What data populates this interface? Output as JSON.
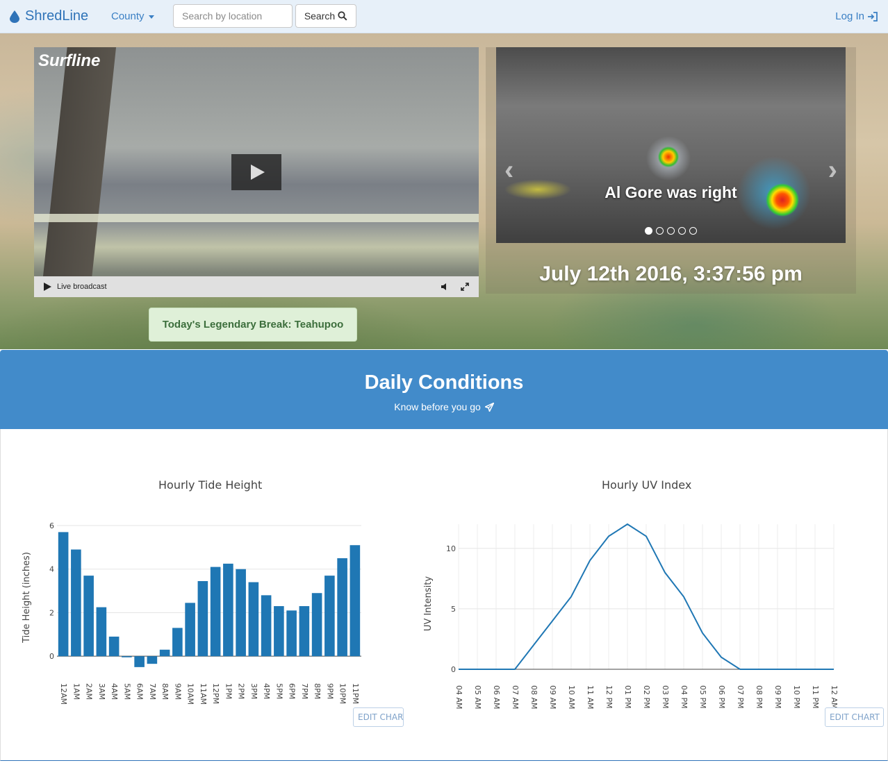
{
  "nav": {
    "brand": "ShredLine",
    "county_label": "County",
    "search_placeholder": "Search by location",
    "search_label": "Search",
    "login_label": "Log In"
  },
  "hero": {
    "video_logo": "Surfline",
    "video_status": "Live broadcast",
    "carousel_caption": "Al Gore was right",
    "carousel_slide_count": 5,
    "carousel_active_index": 0,
    "datetime": "July 12th 2016, 3:37:56 pm",
    "legendary_break": "Today's Legendary Break: Teahupoo"
  },
  "conditions": {
    "title": "Daily Conditions",
    "subtitle": "Know before you go"
  },
  "edit_chart_label": "EDIT CHART",
  "chart_data": [
    {
      "type": "bar",
      "title": "Hourly Tide Height",
      "xlabel": "",
      "ylabel": "Tide Height (inches)",
      "ylim": [
        -0.6,
        6
      ],
      "yticks": [
        0,
        2,
        4,
        6
      ],
      "categories": [
        "12AM",
        "1AM",
        "2AM",
        "3AM",
        "4AM",
        "5AM",
        "6AM",
        "7AM",
        "8AM",
        "9AM",
        "10AM",
        "11AM",
        "12PM",
        "1PM",
        "2PM",
        "3PM",
        "4PM",
        "5PM",
        "6PM",
        "7PM",
        "8PM",
        "9PM",
        "10PM",
        "11PM"
      ],
      "values": [
        5.7,
        4.9,
        3.7,
        2.25,
        0.9,
        -0.05,
        -0.5,
        -0.35,
        0.3,
        1.3,
        2.45,
        3.45,
        4.1,
        4.25,
        4.0,
        3.4,
        2.8,
        2.3,
        2.1,
        2.3,
        2.9,
        3.7,
        4.5,
        5.1
      ],
      "color": "#1f77b4",
      "grid": true
    },
    {
      "type": "line",
      "title": "Hourly UV Index",
      "xlabel": "",
      "ylabel": "UV Intensity",
      "ylim": [
        0,
        12
      ],
      "yticks": [
        0,
        5,
        10
      ],
      "categories": [
        "04 AM",
        "05 AM",
        "06 AM",
        "07 AM",
        "08 AM",
        "09 AM",
        "10 AM",
        "11 AM",
        "12 PM",
        "01 PM",
        "02 PM",
        "03 PM",
        "04 PM",
        "05 PM",
        "06 PM",
        "07 PM",
        "08 PM",
        "09 PM",
        "10 PM",
        "11 PM",
        "12 AM"
      ],
      "values": [
        0,
        0,
        0,
        0,
        2,
        4,
        6,
        9,
        11,
        12,
        11,
        8,
        6,
        3,
        1,
        0,
        0,
        0,
        0,
        0,
        0
      ],
      "color": "#1f77b4",
      "grid": true
    }
  ]
}
